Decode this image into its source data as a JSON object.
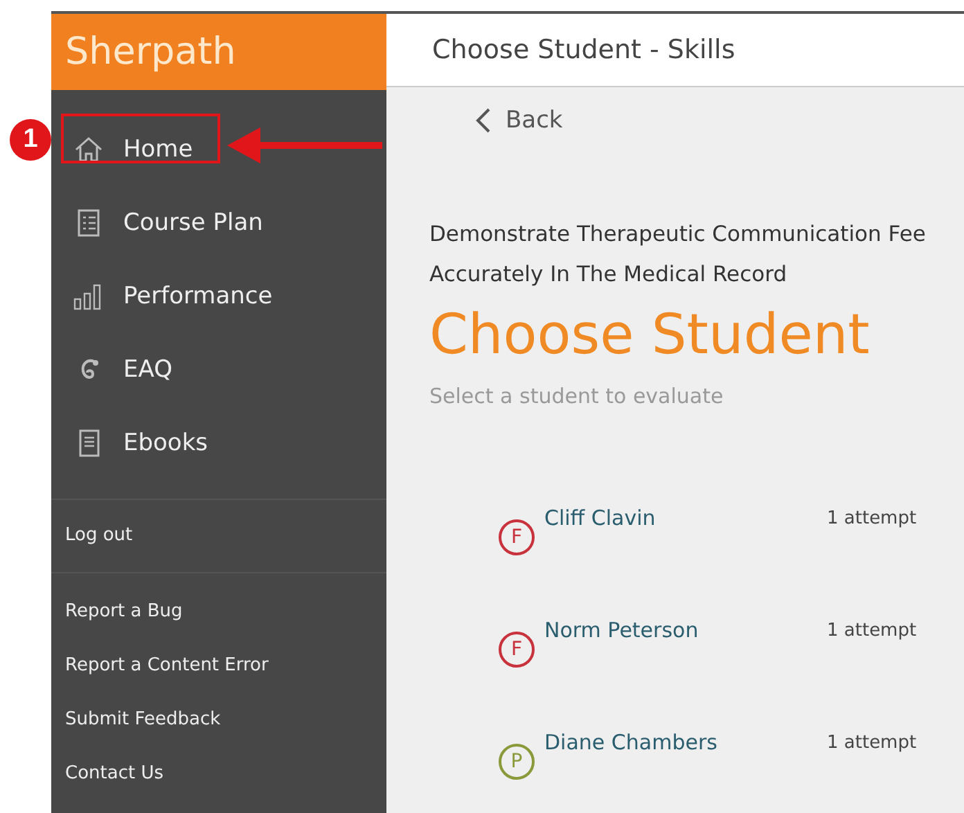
{
  "brand": "Sherpath",
  "nav": [
    {
      "label": "Home",
      "kind": "home"
    },
    {
      "label": "Course Plan",
      "kind": "plan"
    },
    {
      "label": "Performance",
      "kind": "performance"
    },
    {
      "label": "EAQ",
      "kind": "eaq"
    },
    {
      "label": "Ebooks",
      "kind": "ebook"
    }
  ],
  "logout": "Log out",
  "footer_links": [
    "Report a Bug",
    "Report a Content Error",
    "Submit Feedback",
    "Contact Us"
  ],
  "header_title": "Choose Student - Skills",
  "back": "Back",
  "skill_lines": [
    "Demonstrate Therapeutic Communication Fee",
    "Accurately In The Medical Record"
  ],
  "heading": "Choose Student",
  "subtitle": "Select a student to evaluate",
  "students": [
    {
      "grade": "F",
      "color": "#c8323c",
      "name": "Cliff Clavin",
      "attempts": "1 attempt"
    },
    {
      "grade": "F",
      "color": "#c8323c",
      "name": "Norm Peterson",
      "attempts": "1 attempt"
    },
    {
      "grade": "P",
      "color": "#8a9a3a",
      "name": "Diane Chambers",
      "attempts": "1 attempt"
    }
  ],
  "annotation": {
    "number": "1"
  }
}
